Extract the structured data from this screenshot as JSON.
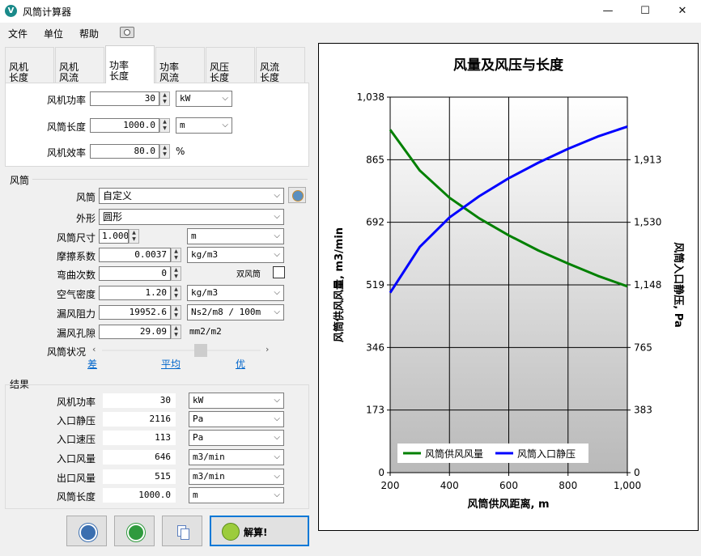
{
  "window": {
    "title": "风筒计算器",
    "app_icon": "V",
    "minimize": "—",
    "maximize": "☐",
    "close": "✕"
  },
  "menu": [
    "文件",
    "单位",
    "帮助"
  ],
  "tabs": [
    {
      "line1": "风机",
      "line2": "长度"
    },
    {
      "line1": "风机",
      "line2": "风流"
    },
    {
      "line1": "功率",
      "line2": "长度"
    },
    {
      "line1": "功率",
      "line2": "风流"
    },
    {
      "line1": "风压",
      "line2": "长度"
    },
    {
      "line1": "风流",
      "line2": "长度"
    }
  ],
  "inputs": {
    "fan_power": {
      "label": "风机功率",
      "value": "30",
      "unit": "kW"
    },
    "duct_length": {
      "label": "风筒长度",
      "value": "1000.0",
      "unit": "m"
    },
    "fan_efficiency": {
      "label": "风机效率",
      "value": "80.0",
      "unit": "%"
    }
  },
  "duct": {
    "group_title": "风筒",
    "duct_label": "风筒",
    "duct_value": "自定义",
    "shape_label": "外形",
    "shape_value": "圆形",
    "size_label": "风筒尺寸",
    "size_value": "1.000",
    "size_unit": "m",
    "friction_label": "摩擦系数",
    "friction_value": "0.0037",
    "friction_unit": "kg/m3",
    "bends_label": "弯曲次数",
    "bends_value": "0",
    "double_label": "双风筒",
    "air_density_label": "空气密度",
    "air_density_value": "1.20",
    "air_density_unit": "kg/m3",
    "leak_res_label": "漏风阻力",
    "leak_res_value": "19952.6",
    "leak_res_unit": "Ns2/m8 / 100m",
    "leak_hole_label": "漏风孔隙",
    "leak_hole_value": "29.09",
    "leak_hole_unit": "mm2/m2",
    "condition_label": "风筒状况",
    "condition_poor": "差",
    "condition_avg": "平均",
    "condition_good": "优",
    "condition_level": 0.62
  },
  "results": {
    "group_title": "结果",
    "rows": [
      {
        "label": "风机功率",
        "value": "30",
        "unit": "kW"
      },
      {
        "label": "入口静压",
        "value": "2116",
        "unit": "Pa"
      },
      {
        "label": "入口速压",
        "value": "113",
        "unit": "Pa"
      },
      {
        "label": "入口风量",
        "value": "646",
        "unit": "m3/min"
      },
      {
        "label": "出口风量",
        "value": "515",
        "unit": "m3/min"
      },
      {
        "label": "风筒长度",
        "value": "1000.0",
        "unit": "m"
      }
    ]
  },
  "buttons": {
    "solve": "解算!"
  },
  "colors": {
    "flow": "#008000",
    "pressure": "#0000ff"
  },
  "chart_data": {
    "type": "line",
    "title": "风量及风压与长度",
    "xlabel": "风筒供风距离, m",
    "ylabel": "风筒供风风量, m3/min",
    "y2label": "风筒入口静压, Pa",
    "xlim": [
      200,
      1000
    ],
    "ylim": [
      0,
      1038
    ],
    "y2lim": [
      0,
      2296
    ],
    "x_ticks": [
      "200",
      "400",
      "600",
      "800",
      "1,000"
    ],
    "y_ticks": [
      "0",
      "173",
      "346",
      "519",
      "692",
      "865",
      "1,038"
    ],
    "y2_ticks": [
      "0",
      "383",
      "765",
      "1,148",
      "1,530",
      "1,913"
    ],
    "grid": true,
    "legend": "bottom",
    "series": [
      {
        "name": "风筒供风风量",
        "axis": "left",
        "color": "#008000",
        "x": [
          200,
          300,
          400,
          500,
          600,
          700,
          800,
          900,
          1000
        ],
        "y": [
          948,
          835,
          760,
          703,
          656,
          614,
          578,
          544,
          515
        ]
      },
      {
        "name": "风筒入口静压",
        "axis": "right",
        "color": "#0000ff",
        "x": [
          200,
          300,
          400,
          500,
          600,
          700,
          800,
          900,
          1000
        ],
        "y": [
          1100,
          1380,
          1560,
          1690,
          1800,
          1895,
          1980,
          2055,
          2116
        ]
      }
    ]
  }
}
